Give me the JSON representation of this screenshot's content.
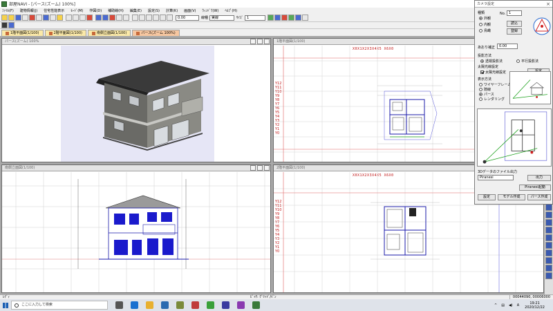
{
  "window": {
    "title": "部屋NAVI - [パース(ズーム) 100%]"
  },
  "menu": [
    "ﾌｧｲﾙ(F)",
    "建物情報(J)",
    "住宅性能表示",
    "ﾓｰﾄﾞ(M)",
    "作図(D)",
    "補助線(H)",
    "編集(E)",
    "設定(S)",
    "計算(K)",
    "画面(V)",
    "ｳｨﾝﾄﾞｳ(W)",
    "ﾍﾙﾌﾟ(H)"
  ],
  "toolbar": {
    "scale_value": "0.00",
    "linetype_label": "線種",
    "linetype_value": "実線",
    "size_label": "ｻｲｽﾞ",
    "size_value": "1"
  },
  "tabs": [
    {
      "label": "1階平面図(1/100)"
    },
    {
      "label": "2階平面図(1/100)"
    },
    {
      "label": "南側立面図(1/100)"
    },
    {
      "label": "パース(ズーム 100%)"
    }
  ],
  "panels": {
    "render": {
      "title": "パース(ズーム) 100%"
    },
    "elevation": {
      "title": "南側立面図(1/100)"
    },
    "plan1": {
      "title": "1階平面図(1/100)",
      "x_header": "X0X1X2X3X4X5 X6X0"
    },
    "plan2": {
      "title": "2階平面図(1/100)",
      "x_header": "X0X1X2X3X4X5 X6X0"
    }
  },
  "y_axis_labels": [
    "Y12",
    "Y11",
    "Y10",
    "Y9",
    "Y8",
    "Y7",
    "Y6",
    "Y5",
    "Y4",
    "Y3",
    "Y2",
    "Y1",
    "Y0"
  ],
  "dialog": {
    "title": "カメラ設定",
    "kind_label": "種類",
    "kinds": [
      "外観",
      "内観",
      "鳥瞰"
    ],
    "no_label": "No.",
    "no_value": "1",
    "btn_read": "読込",
    "btn_register": "登録",
    "height_label": "あおり補正",
    "height_value": "0.00",
    "projection_label": "投影方法",
    "projection_options": [
      "透視投影法",
      "平行投影法"
    ],
    "sun_label": "太陽光線設定",
    "sun_check": "太陽光線設定",
    "btn_settings": "設定",
    "display_label": "表示方法",
    "display_options": [
      "ワイヤーフレーム",
      "隠線",
      "パース",
      "レンダリング"
    ],
    "export_label": "3Dデータのファイル出力",
    "export_format": "Piranesi",
    "btn_output": "出力",
    "btn_piranesi": "Piranesi起動",
    "btn_set": "設定",
    "btn_model": "モデル作成",
    "btn_perspective": "パース作成"
  },
  "status": {
    "left": "ﾚﾃﾞｨ",
    "mid": "ﾋﾟｯﾁ: ｸﾞﾘｯﾄﾞ/ﾊﾟﾝ",
    "coords": "00044090, 00006000"
  },
  "taskbar": {
    "search_placeholder": "ここに入力して検索",
    "time": "19:21",
    "date": "2020/12/22"
  }
}
